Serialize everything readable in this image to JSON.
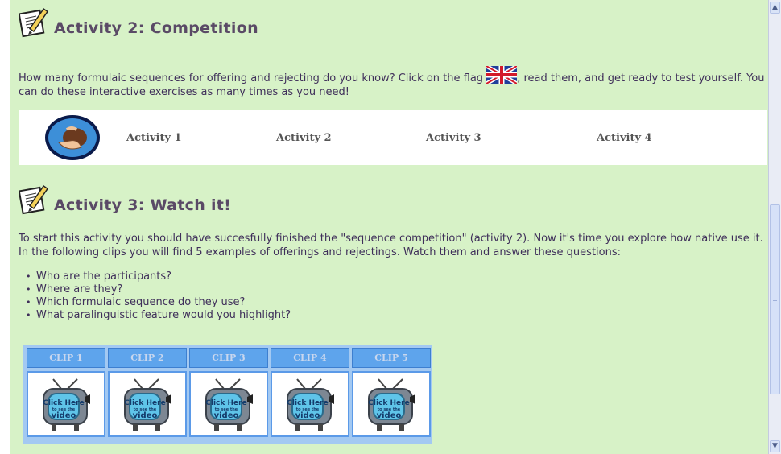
{
  "activity2": {
    "title": "Activity 2: Competition",
    "text_before_flag": "How many formulaic sequences for offering and rejecting do you know? Click on the flag ",
    "text_after_flag": ", read them, and get ready to test yourself. You can do these interactive exercises as many times as you need!",
    "links": [
      "Activity 1",
      "Activity 2",
      "Activity 3",
      "Activity 4"
    ]
  },
  "activity3": {
    "title": "Activity 3: Watch it!",
    "text": "To start this activity you should have succesfully finished the \"sequence competition\" (activity 2). Now it's time you explore how native use it. In the following clips you will find 5 examples of offerings and rejectings. Watch them and answer these questions:",
    "questions": [
      "Who are the participants?",
      "Where are they?",
      "Which formulaic sequence do they use?",
      "What paralinguistic feature would you highlight?"
    ]
  },
  "clips": [
    {
      "label": "CLIP 1"
    },
    {
      "label": "CLIP 2"
    },
    {
      "label": "CLIP 3"
    },
    {
      "label": "CLIP 4"
    },
    {
      "label": "CLIP 5"
    }
  ],
  "tv_button": {
    "line1": "Click Here",
    "line2": "to see the",
    "line3": "video"
  },
  "colors": {
    "page_bg": "#d7f2c7",
    "clip_header": "#5ea4ec",
    "clip_frame": "#a3c9f2"
  },
  "icons": {
    "notepad": "notepad-pencil-icon",
    "flag": "uk-flag-icon",
    "logo": "hand-ball-logo",
    "tv": "tv-click-here-icon"
  }
}
